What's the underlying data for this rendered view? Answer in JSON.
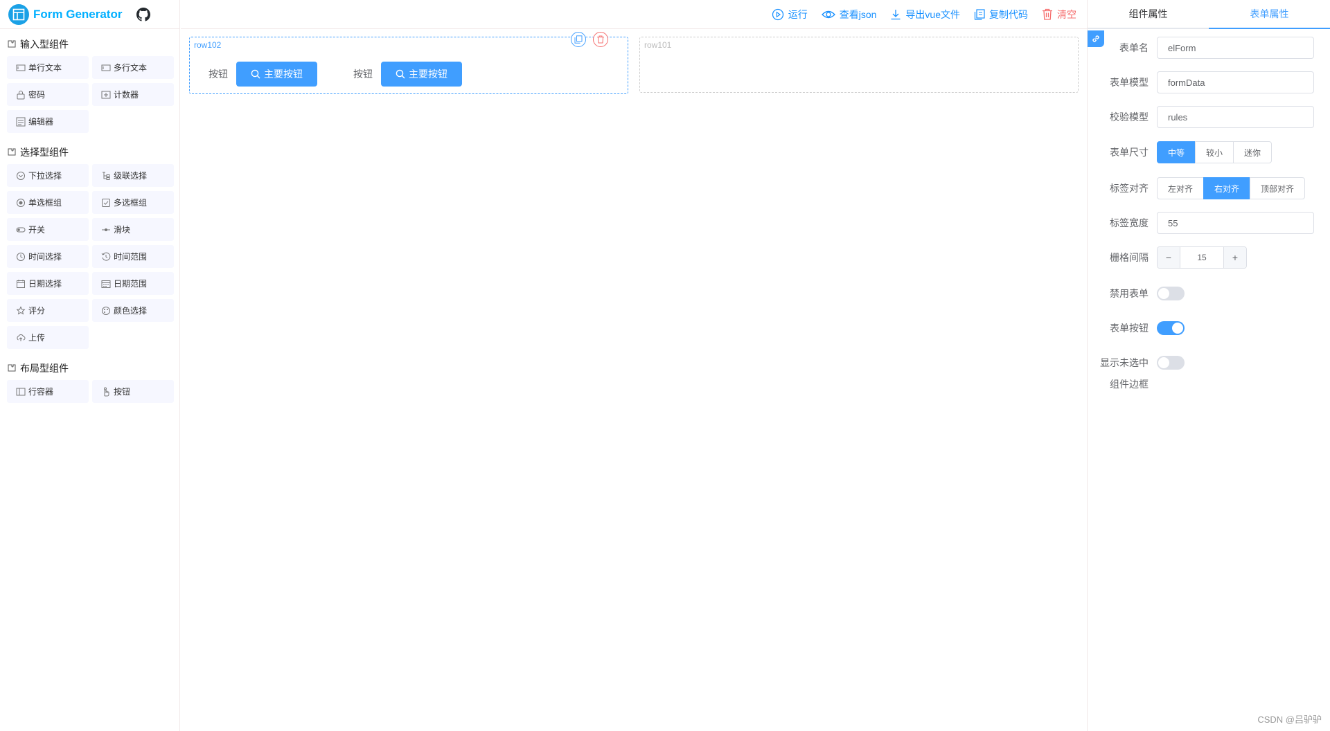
{
  "app": {
    "title": "Form Generator"
  },
  "left": {
    "categories": [
      {
        "title": "输入型组件",
        "items": [
          "单行文本",
          "多行文本",
          "密码",
          "计数器",
          "编辑器"
        ]
      },
      {
        "title": "选择型组件",
        "items": [
          "下拉选择",
          "级联选择",
          "单选框组",
          "多选框组",
          "开关",
          "滑块",
          "时间选择",
          "时间范围",
          "日期选择",
          "日期范围",
          "评分",
          "颜色选择",
          "上传"
        ]
      },
      {
        "title": "布局型组件",
        "items": [
          "行容器",
          "按钮"
        ]
      }
    ]
  },
  "toolbar": {
    "run": "运行",
    "view_json": "查看json",
    "export_vue": "导出vue文件",
    "copy_code": "复制代码",
    "clear": "清空"
  },
  "canvas": {
    "rows": [
      {
        "label": "row102",
        "fields": [
          {
            "label": "按钮",
            "button": "主要按钮"
          },
          {
            "label": "按钮",
            "button": "主要按钮"
          }
        ]
      },
      {
        "label": "row101"
      }
    ]
  },
  "right": {
    "tabs": [
      "组件属性",
      "表单属性"
    ],
    "props": {
      "form_name": {
        "label": "表单名",
        "value": "elForm"
      },
      "form_model": {
        "label": "表单模型",
        "value": "formData"
      },
      "rules_model": {
        "label": "校验模型",
        "value": "rules"
      },
      "size": {
        "label": "表单尺寸",
        "options": [
          "中等",
          "较小",
          "迷你"
        ],
        "selected": "中等"
      },
      "label_align": {
        "label": "标签对齐",
        "options": [
          "左对齐",
          "右对齐",
          "顶部对齐"
        ],
        "selected": "右对齐"
      },
      "label_width": {
        "label": "标签宽度",
        "value": "55"
      },
      "gutter": {
        "label": "栅格间隔",
        "value": "15",
        "minus": "−",
        "plus": "+"
      },
      "disabled": {
        "label": "禁用表单",
        "on": false
      },
      "form_btns": {
        "label": "表单按钮",
        "on": true
      },
      "unfocused_border": {
        "label": "显示未选中",
        "label2": "组件边框",
        "on": false
      }
    }
  },
  "footer": {
    "watermark": "CSDN @吕驴驴"
  },
  "colors": {
    "accent": "#409eff",
    "logo": "#00afff",
    "danger": "#f56c6c"
  }
}
